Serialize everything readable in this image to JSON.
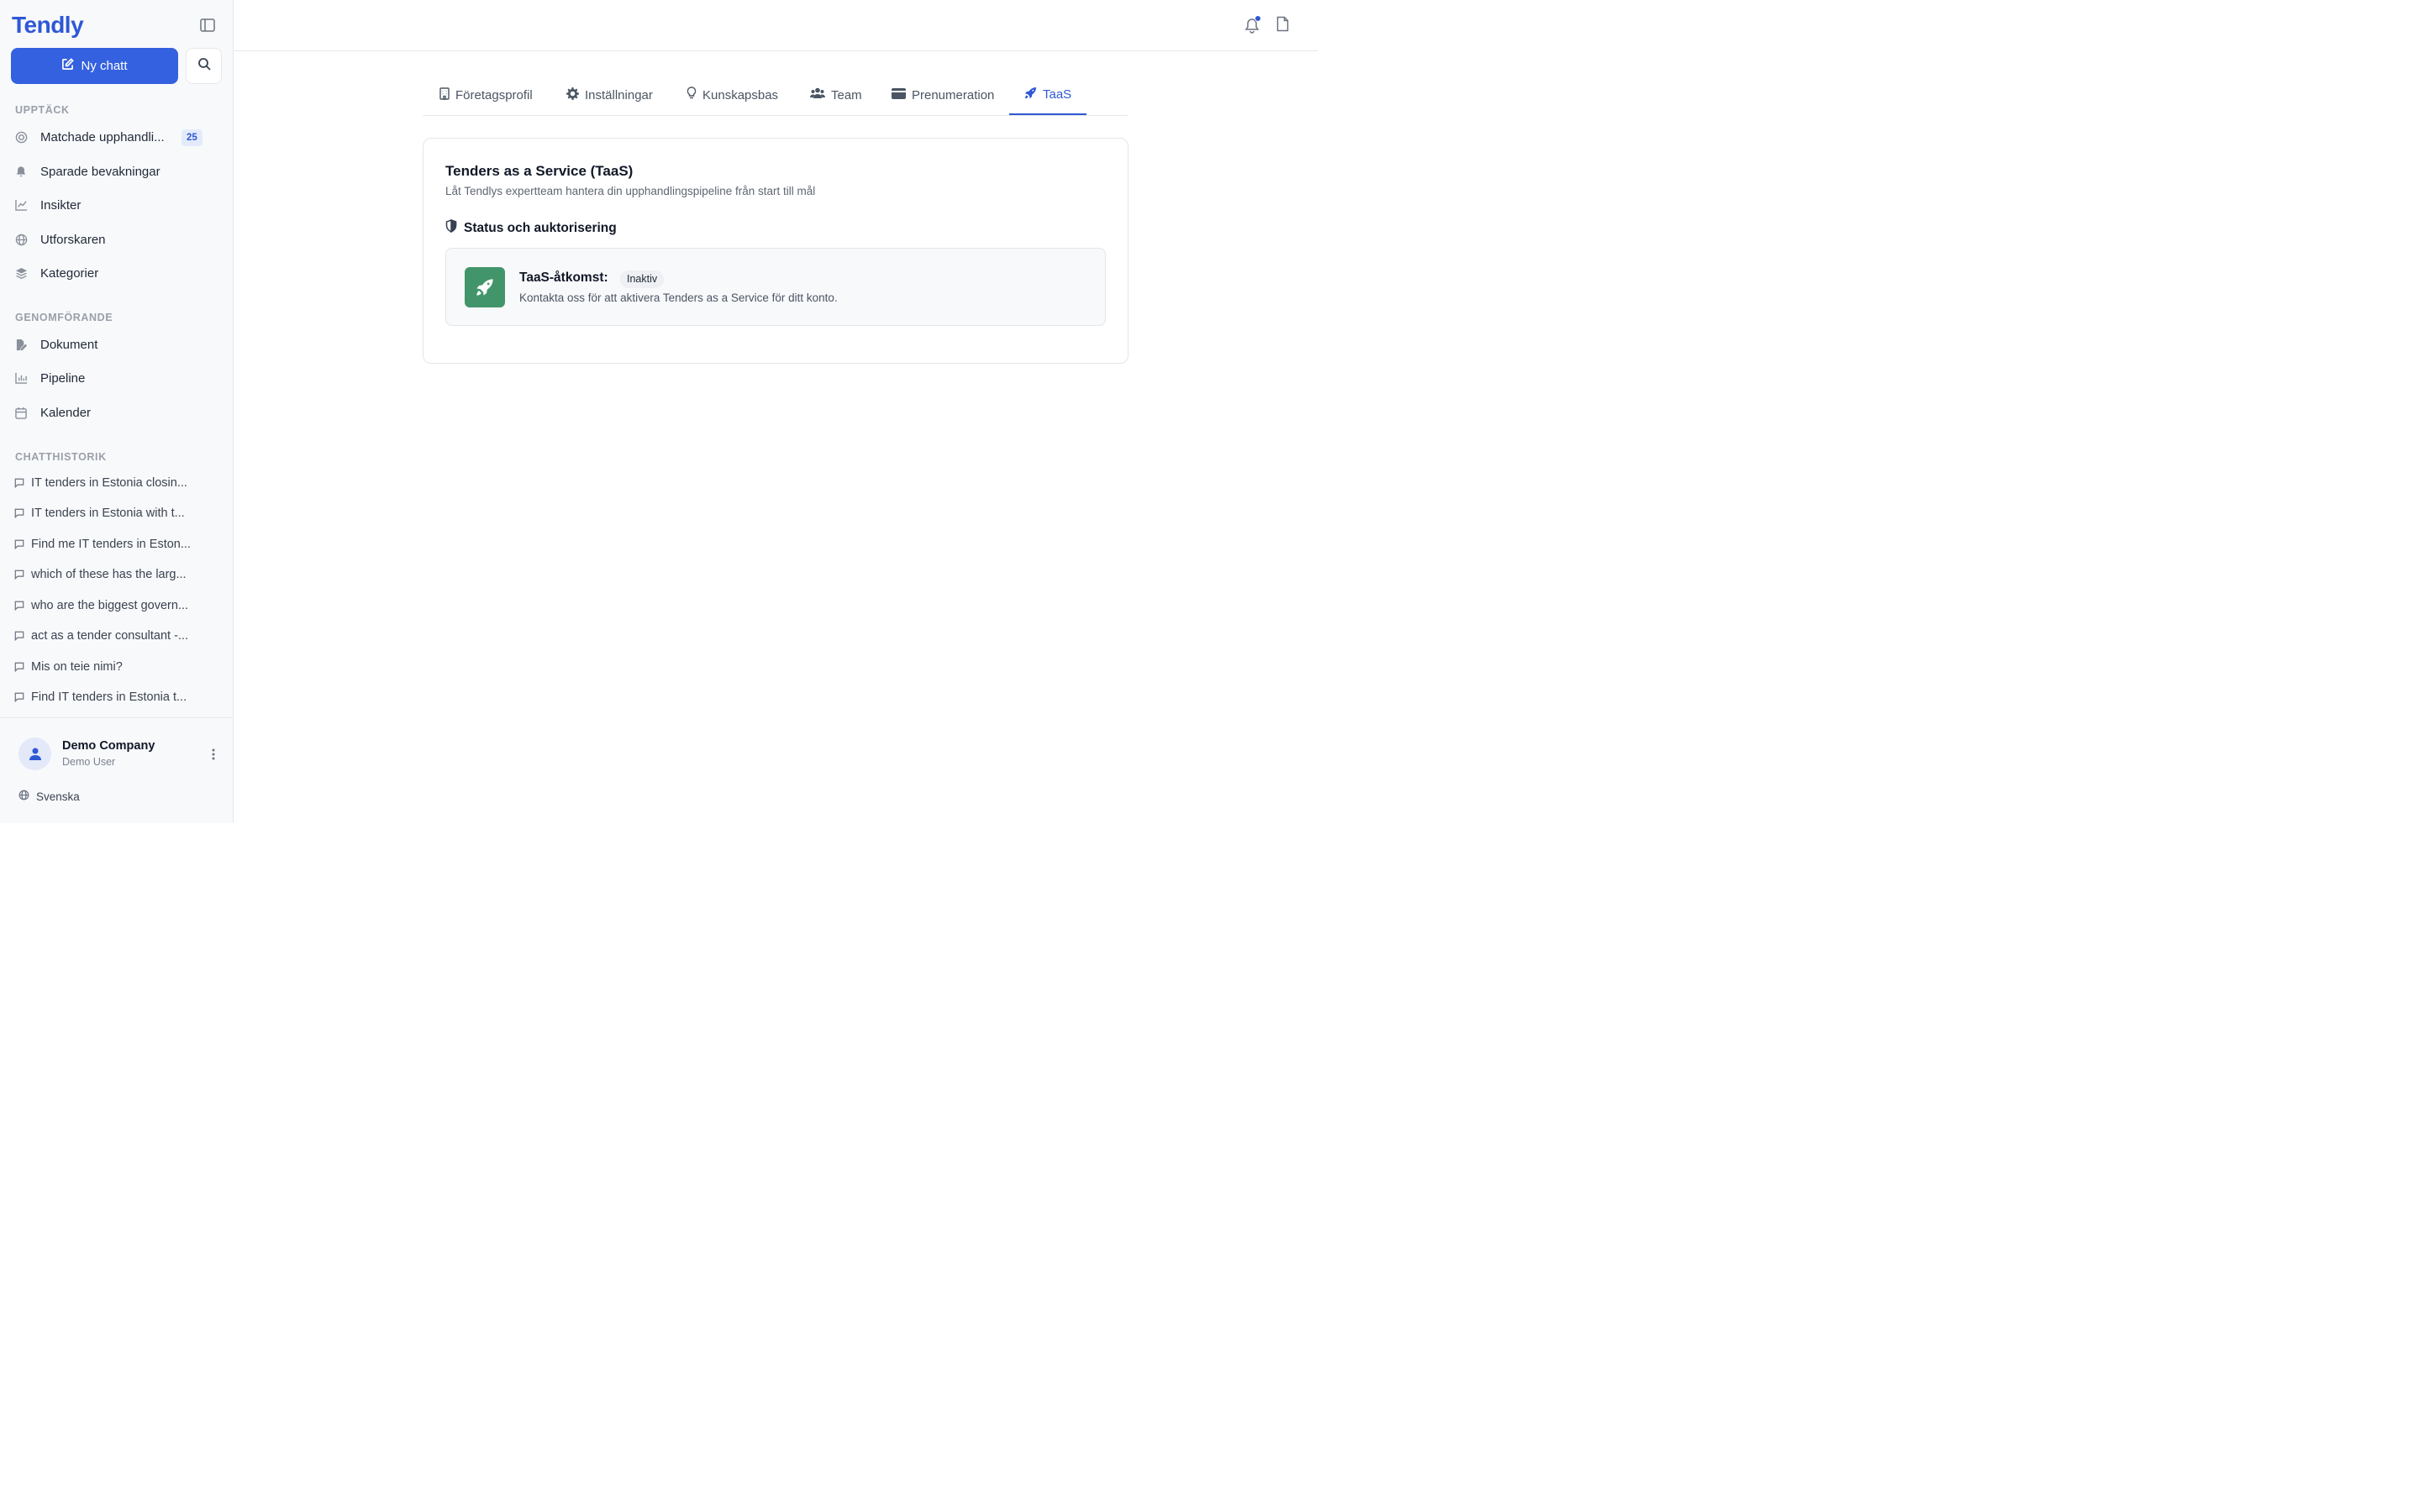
{
  "sidebar": {
    "logo": "Tendly",
    "new_chat_label": "Ny chatt",
    "sections": {
      "discover": "UPPTÄCK",
      "execution": "GENOMFÖRANDE",
      "chat_history": "CHATTHISTORIK"
    },
    "discover_items": [
      {
        "label": "Matchade upphandli...",
        "icon": "target-icon",
        "badge": "25"
      },
      {
        "label": "Sparade bevakningar",
        "icon": "bell-icon"
      },
      {
        "label": "Insikter",
        "icon": "line-chart-icon"
      },
      {
        "label": "Utforskaren",
        "icon": "globe-icon"
      },
      {
        "label": "Kategorier",
        "icon": "layers-icon"
      }
    ],
    "execution_items": [
      {
        "label": "Dokument",
        "icon": "document-edit-icon"
      },
      {
        "label": "Pipeline",
        "icon": "bar-chart-icon"
      },
      {
        "label": "Kalender",
        "icon": "calendar-icon"
      }
    ],
    "chat_history": [
      "IT tenders in Estonia closin...",
      "IT tenders in Estonia with t...",
      "Find me IT tenders in Eston...",
      "which of these has the larg...",
      "who are the biggest govern...",
      "act as a tender consultant -...",
      "Mis on teie nimi?",
      "Find IT tenders in Estonia t..."
    ],
    "user": {
      "name": "Demo Company",
      "role": "Demo User"
    },
    "language": "Svenska"
  },
  "tabs": [
    {
      "label": "Företagsprofil",
      "icon": "building-icon"
    },
    {
      "label": "Inställningar",
      "icon": "gear-icon"
    },
    {
      "label": "Kunskapsbas",
      "icon": "lightbulb-icon"
    },
    {
      "label": "Team",
      "icon": "users-icon"
    },
    {
      "label": "Prenumeration",
      "icon": "credit-card-icon"
    },
    {
      "label": "TaaS",
      "icon": "rocket-icon",
      "active": true
    }
  ],
  "card": {
    "title": "Tenders as a Service (TaaS)",
    "subtitle": "Låt Tendlys expertteam hantera din upphandlingspipeline från start till mål",
    "section_title": "Status och auktorisering",
    "access_label": "TaaS-åtkomst:",
    "status": "Inaktiv",
    "description": "Kontakta oss för att aktivera Tenders as a Service för ditt konto."
  },
  "colors": {
    "accent": "#3461e0",
    "rocket_tile": "#42956a",
    "badge_bg": "#e3ebfb"
  }
}
